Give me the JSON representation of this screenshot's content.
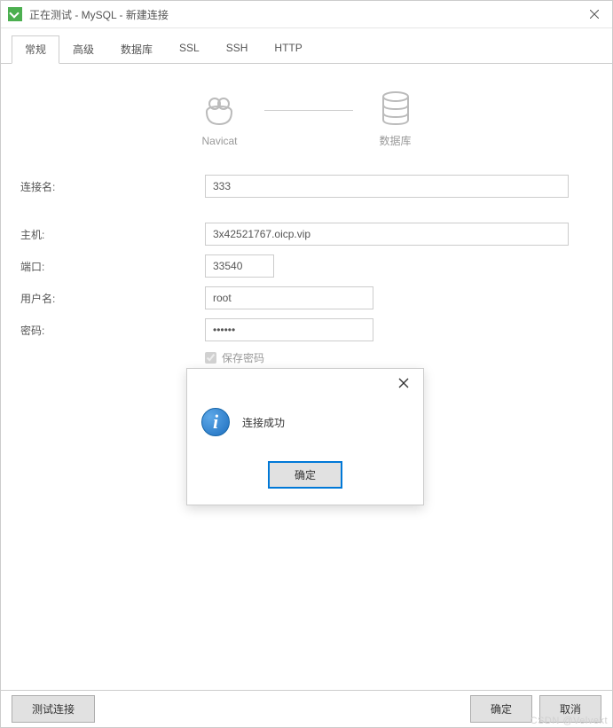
{
  "window": {
    "title": "正在测试 - MySQL - 新建连接"
  },
  "tabs": [
    {
      "label": "常规",
      "active": true
    },
    {
      "label": "高级",
      "active": false
    },
    {
      "label": "数据库",
      "active": false
    },
    {
      "label": "SSL",
      "active": false
    },
    {
      "label": "SSH",
      "active": false
    },
    {
      "label": "HTTP",
      "active": false
    }
  ],
  "diagram": {
    "left": "Navicat",
    "right": "数据库"
  },
  "form": {
    "conn_name_label": "连接名:",
    "conn_name_value": "333",
    "host_label": "主机:",
    "host_value": "3x42521767.oicp.vip",
    "port_label": "端口:",
    "port_value": "33540",
    "user_label": "用户名:",
    "user_value": "root",
    "pass_label": "密码:",
    "pass_value": "••••••",
    "save_pass_label": "保存密码"
  },
  "footer": {
    "test_label": "测试连接",
    "ok_label": "确定",
    "cancel_label": "取消"
  },
  "modal": {
    "message": "连接成功",
    "ok_label": "确定"
  },
  "watermark": "CSDN @Velvekt"
}
